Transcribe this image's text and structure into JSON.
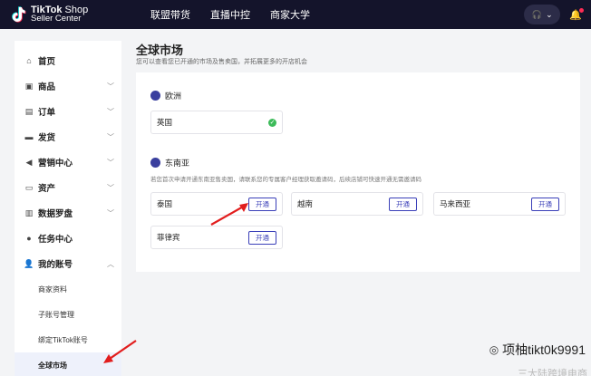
{
  "header": {
    "logo_line1": "TikTok",
    "logo_line1_suffix": " Shop",
    "logo_line2": "Seller Center",
    "nav": [
      "联盟带货",
      "直播中控",
      "商家大学"
    ]
  },
  "sidebar": {
    "items": [
      {
        "label": "首页",
        "icon": "home-icon"
      },
      {
        "label": "商品",
        "icon": "product-icon"
      },
      {
        "label": "订单",
        "icon": "order-icon"
      },
      {
        "label": "发货",
        "icon": "shipping-icon"
      },
      {
        "label": "营销中心",
        "icon": "megaphone-icon"
      },
      {
        "label": "资产",
        "icon": "wallet-icon"
      },
      {
        "label": "数据罗盘",
        "icon": "chart-icon"
      },
      {
        "label": "任务中心",
        "icon": "task-icon"
      },
      {
        "label": "我的账号",
        "icon": "user-icon"
      }
    ],
    "subitems": [
      "商家资料",
      "子账号管理",
      "绑定TikTok账号",
      "全球市场"
    ]
  },
  "main": {
    "title": "全球市场",
    "description": "您可以查看您已开通的市场及售卖国，并拓展更多的开店机会",
    "europe": {
      "region": "欧洲",
      "markets": [
        "英国"
      ]
    },
    "sea": {
      "region": "东南亚",
      "note": "若您首次申请开通东南亚售卖国，请联系您的专属客户经理获取邀请码，后续店铺可快速开通无需邀请码",
      "markets": [
        "泰国",
        "越南",
        "马来西亚",
        "菲律宾"
      ],
      "open_label": "开通"
    }
  },
  "watermark": {
    "text": "项柚tikt0k9991",
    "text2": "三大陆跨境电商"
  }
}
